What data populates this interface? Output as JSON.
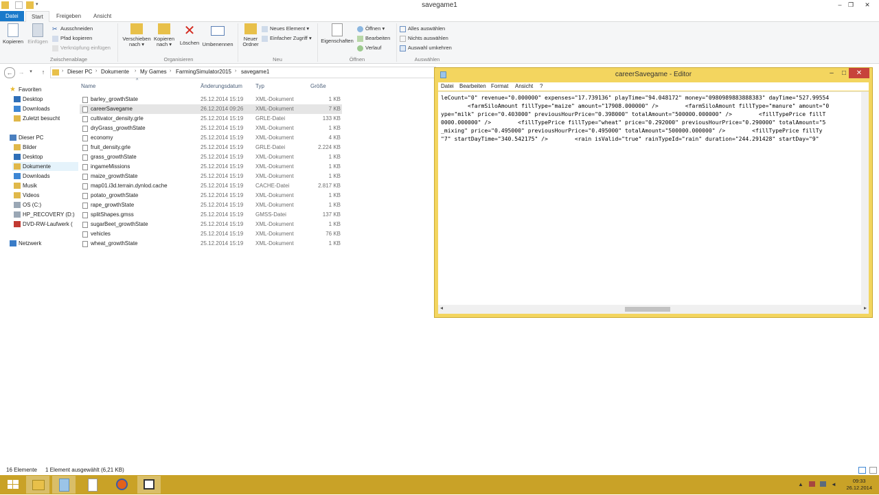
{
  "window": {
    "title": "savegame1"
  },
  "ribbon_tabs": [
    "Datei",
    "Start",
    "Freigeben",
    "Ansicht"
  ],
  "ribbon": {
    "clipboard": {
      "copy": "Kopieren",
      "paste": "Einfügen",
      "cut": "Ausschneiden",
      "copy_path": "Pfad kopieren",
      "paste_shortcut": "Verknüpfung einfügen",
      "label": "Zwischenablage"
    },
    "organize": {
      "move_to_1": "Verschieben",
      "move_to_2": "nach",
      "copy_to_1": "Kopieren",
      "copy_to_2": "nach",
      "delete": "Löschen",
      "rename": "Umbenennen",
      "label": "Organisieren"
    },
    "new": {
      "new_folder_1": "Neuer",
      "new_folder_2": "Ordner",
      "new_item": "Neues Element",
      "easy_access": "Einfacher Zugriff",
      "label": "Neu"
    },
    "open": {
      "properties": "Eigenschaften",
      "open": "Öffnen",
      "edit": "Bearbeiten",
      "history": "Verlauf",
      "label": "Öffnen"
    },
    "select": {
      "select_all": "Alles auswählen",
      "select_none": "Nichts auswählen",
      "invert": "Auswahl umkehren",
      "label": "Auswählen"
    }
  },
  "address": {
    "crumbs": [
      "Dieser PC",
      "Dokumente",
      "My Games",
      "FarmingSimulator2015",
      "savegame1"
    ]
  },
  "nav": {
    "favorites": "Favoriten",
    "fav_items": [
      "Desktop",
      "Downloads",
      "Zuletzt besucht"
    ],
    "this_pc": "Dieser PC",
    "pc_items": [
      "Bilder",
      "Desktop",
      "Dokumente",
      "Downloads",
      "Musik",
      "Videos",
      "OS (C:)",
      "HP_RECOVERY (D:)",
      "DVD-RW-Laufwerk ("
    ],
    "network": "Netzwerk"
  },
  "columns": {
    "name": "Name",
    "date": "Änderungsdatum",
    "type": "Typ",
    "size": "Größe"
  },
  "files": [
    {
      "name": "barley_growthState",
      "date": "25.12.2014 15:19",
      "type": "XML-Dokument",
      "size": "1 KB"
    },
    {
      "name": "careerSavegame",
      "date": "26.12.2014 09:26",
      "type": "XML-Dokument",
      "size": "7 KB"
    },
    {
      "name": "cultivator_density.grle",
      "date": "25.12.2014 15:19",
      "type": "GRLE-Datei",
      "size": "133 KB"
    },
    {
      "name": "dryGrass_growthState",
      "date": "25.12.2014 15:19",
      "type": "XML-Dokument",
      "size": "1 KB"
    },
    {
      "name": "economy",
      "date": "25.12.2014 15:19",
      "type": "XML-Dokument",
      "size": "4 KB"
    },
    {
      "name": "fruit_density.grle",
      "date": "25.12.2014 15:19",
      "type": "GRLE-Datei",
      "size": "2.224 KB"
    },
    {
      "name": "grass_growthState",
      "date": "25.12.2014 15:19",
      "type": "XML-Dokument",
      "size": "1 KB"
    },
    {
      "name": "ingameMissions",
      "date": "25.12.2014 15:19",
      "type": "XML-Dokument",
      "size": "1 KB"
    },
    {
      "name": "maize_growthState",
      "date": "25.12.2014 15:19",
      "type": "XML-Dokument",
      "size": "1 KB"
    },
    {
      "name": "map01.i3d.terrain.dynlod.cache",
      "date": "25.12.2014 15:19",
      "type": "CACHE-Datei",
      "size": "2.817 KB"
    },
    {
      "name": "potato_growthState",
      "date": "25.12.2014 15:19",
      "type": "XML-Dokument",
      "size": "1 KB"
    },
    {
      "name": "rape_growthState",
      "date": "25.12.2014 15:19",
      "type": "XML-Dokument",
      "size": "1 KB"
    },
    {
      "name": "splitShapes.gmss",
      "date": "25.12.2014 15:19",
      "type": "GMSS-Datei",
      "size": "137 KB"
    },
    {
      "name": "sugarBeet_growthState",
      "date": "25.12.2014 15:19",
      "type": "XML-Dokument",
      "size": "1 KB"
    },
    {
      "name": "vehicles",
      "date": "25.12.2014 15:19",
      "type": "XML-Dokument",
      "size": "76 KB"
    },
    {
      "name": "wheat_growthState",
      "date": "25.12.2014 15:19",
      "type": "XML-Dokument",
      "size": "1 KB"
    }
  ],
  "status": {
    "count": "16 Elemente",
    "selection": "1 Element ausgewählt (6,21 KB)"
  },
  "taskbar": {
    "time": "09:33",
    "date": "26.12.2014"
  },
  "notepad": {
    "title": "careerSavegame - Editor",
    "menus": [
      "Datei",
      "Bearbeiten",
      "Format",
      "Ansicht",
      "?"
    ],
    "lines": [
      "leCount=\"0\" revenue=\"0.000000\" expenses=\"17.739136\" playTime=\"94.048172\" money=\"0980989883888383\" dayTime=\"527.99554",
      "        <farmSiloAmount fillType=\"maize\" amount=\"17908.000000\" />        <farmSiloAmount fillType=\"manure\" amount=\"0",
      "ype=\"milk\" price=\"0.403000\" previousHourPrice=\"0.398000\" totalAmount=\"500000.000000\" />        <fillTypePrice fillT",
      "0000.000000\" />        <fillTypePrice fillType=\"wheat\" price=\"0.292000\" previousHourPrice=\"0.290000\" totalAmount=\"5",
      "_mixing\" price=\"0.495000\" previousHourPrice=\"0.495000\" totalAmount=\"500000.000000\" />        <fillTypePrice fillTy",
      "\"7\" startDayTime=\"340.542175\" />        <rain isValid=\"true\" rainTypeId=\"rain\" duration=\"244.291428\" startDay=\"9\" "
    ]
  }
}
